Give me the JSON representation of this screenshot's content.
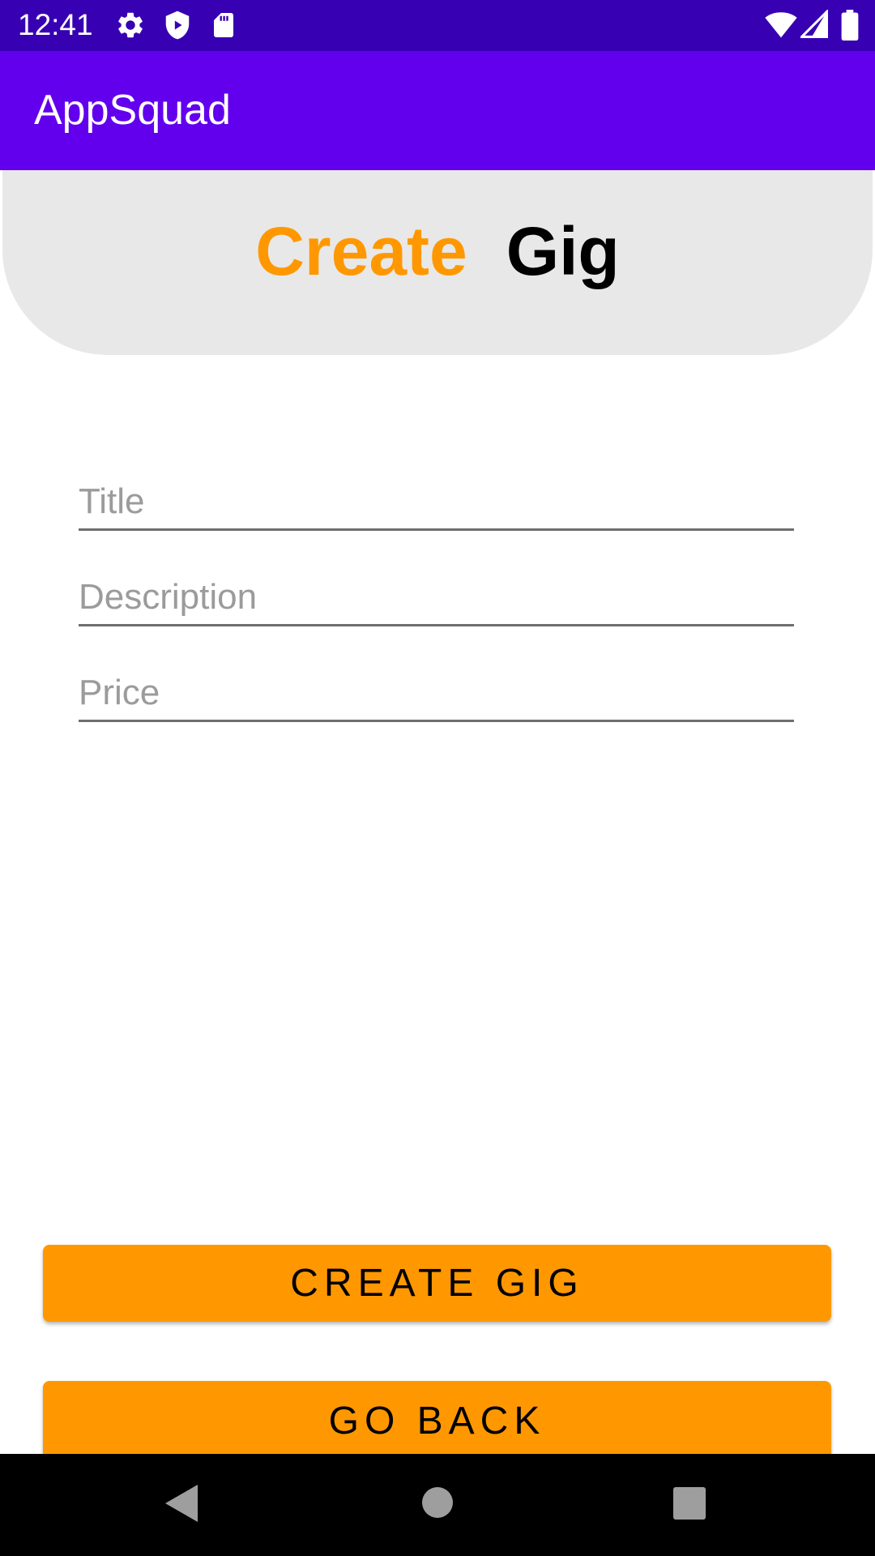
{
  "status_bar": {
    "time": "12:41",
    "left_icons": [
      "gear-icon",
      "shield-icon",
      "sd-card-icon"
    ],
    "right_icons": [
      "wifi-icon",
      "signal-icon",
      "battery-icon"
    ]
  },
  "app_bar": {
    "title": "AppSquad"
  },
  "header": {
    "title_word1": "Create",
    "title_word2": "Gig"
  },
  "form": {
    "title_placeholder": "Title",
    "description_placeholder": "Description",
    "price_placeholder": "Price",
    "title_value": "",
    "description_value": "",
    "price_value": ""
  },
  "buttons": {
    "create_label": "CREATE GIG",
    "back_label": "GO BACK"
  },
  "nav": {
    "icons": [
      "back-icon",
      "home-icon",
      "recents-icon"
    ]
  },
  "colors": {
    "status_bar": "#3700B3",
    "app_bar": "#6200EE",
    "accent": "#FF9800",
    "header_bg": "#E8E8E8"
  }
}
